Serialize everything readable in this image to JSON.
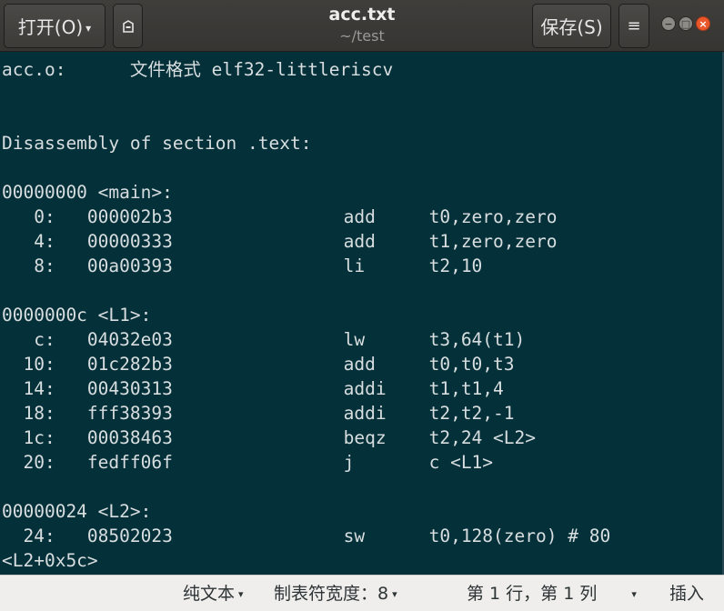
{
  "header": {
    "open_label": "打开(O)",
    "open_caret": "▾",
    "pin_glyph": "⌂",
    "title": "acc.txt",
    "subtitle": "~/test",
    "save_label": "保存(S)",
    "menu_glyph": "≡",
    "min_glyph": "−",
    "max_glyph": "□",
    "close_glyph": "×"
  },
  "editor": {
    "lines": [
      "acc.o:      文件格式 elf32-littleriscv",
      "",
      "",
      "Disassembly of section .text:",
      "",
      "00000000 <main>:",
      "   0:   000002b3                add     t0,zero,zero",
      "   4:   00000333                add     t1,zero,zero",
      "   8:   00a00393                li      t2,10",
      "",
      "0000000c <L1>:",
      "   c:   04032e03                lw      t3,64(t1)",
      "  10:   01c282b3                add     t0,t0,t3",
      "  14:   00430313                addi    t1,t1,4",
      "  18:   fff38393                addi    t2,t2,-1",
      "  1c:   00038463                beqz    t2,24 <L2>",
      "  20:   fedff06f                j       c <L1>",
      "",
      "00000024 <L2>:",
      "  24:   08502023                sw      t0,128(zero) # 80",
      "<L2+0x5c>"
    ]
  },
  "statusbar": {
    "syntax_label": "纯文本",
    "tab_width_label": "制表符宽度：8",
    "position_label": "第 1 行，第 1 列",
    "insert_mode_label": "插入",
    "caret": "▾"
  },
  "colors": {
    "editor_bg": "#04303a",
    "editor_fg": "#d8dedf",
    "header_bg": "#3a3936",
    "status_bg": "#efeeec",
    "close_button": "#e9572a"
  }
}
